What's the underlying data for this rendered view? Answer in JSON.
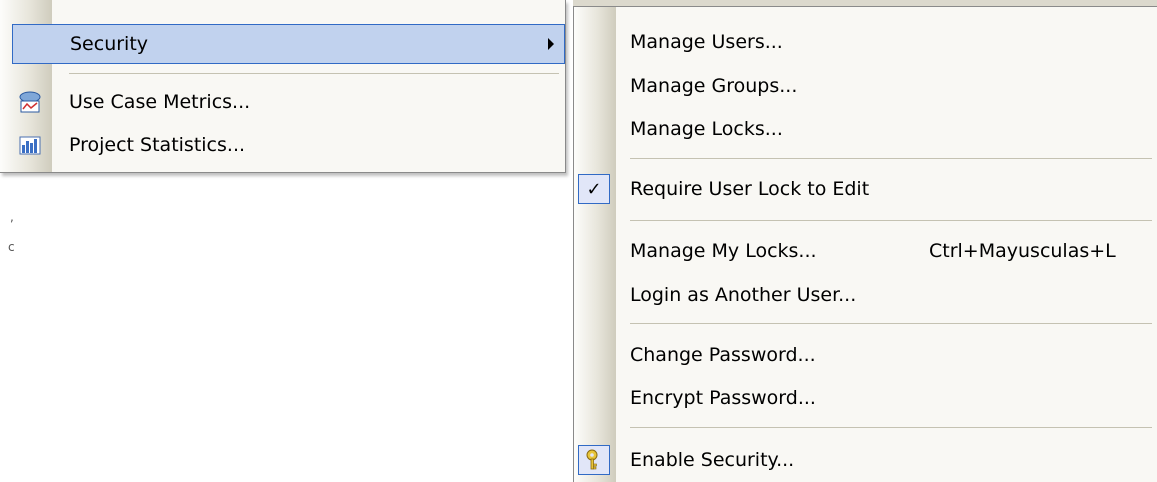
{
  "main_menu": {
    "items": [
      {
        "label": "Security",
        "icon": "",
        "selected": true,
        "has_submenu": true
      },
      {
        "label": "Use Case Metrics...",
        "icon": "use-case-metrics-icon"
      },
      {
        "label": "Project Statistics...",
        "icon": "project-statistics-icon"
      }
    ]
  },
  "security_submenu": {
    "items": [
      {
        "label": "Manage Users...",
        "shortcut": ""
      },
      {
        "label": "Manage Groups...",
        "shortcut": ""
      },
      {
        "label": "Manage Locks...",
        "shortcut": ""
      },
      {
        "label": "Require User Lock to Edit",
        "checked": true,
        "check_icon": "check-icon"
      },
      {
        "label": "Manage My Locks...",
        "shortcut": "Ctrl+Mayusculas+L"
      },
      {
        "label": "Login as Another User...",
        "shortcut": ""
      },
      {
        "label": "Change Password...",
        "shortcut": ""
      },
      {
        "label": "Encrypt Password...",
        "shortcut": ""
      },
      {
        "label": "Enable Security...",
        "icon": "key-icon"
      }
    ]
  },
  "colors": {
    "selection_fill": "#c1d2ee",
    "selection_border": "#316ac5",
    "menu_bg": "#f9f8f4"
  }
}
